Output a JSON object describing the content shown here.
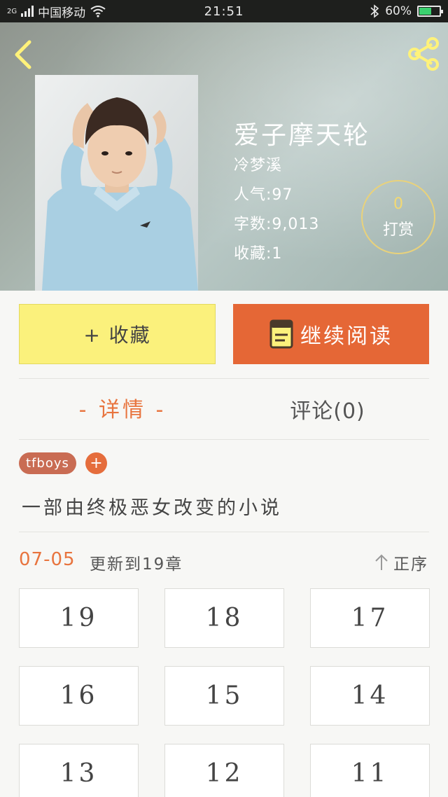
{
  "status_bar": {
    "network": "2G",
    "carrier": "中国移动",
    "time": "21:51",
    "battery": "60%",
    "battery_level": 0.6
  },
  "book": {
    "title": "爱子摩天轮",
    "author": "冷梦溪",
    "popularity": "人气:97",
    "word_count": "字数:9,013",
    "favorites": "收藏:1",
    "reward_count": "0",
    "reward_label": "打赏"
  },
  "actions": {
    "favorite_label": "+ 收藏",
    "read_label": "继续阅读"
  },
  "tabs": {
    "detail": "- 详情 -",
    "comments": "评论(0)"
  },
  "tags": [
    "tfboys"
  ],
  "tag_add": "+",
  "synopsis": "一部由终极恶女改变的小说",
  "update": {
    "date": "07-05",
    "text": "更新到19章",
    "sort_label": "正序"
  },
  "chapters": [
    "19",
    "18",
    "17",
    "16",
    "15",
    "14",
    "13",
    "12",
    "11"
  ],
  "colors": {
    "accent": "#e8743e",
    "favorite_button": "#fbf17c",
    "read_button": "#e56736",
    "tag": "#c96c53"
  }
}
